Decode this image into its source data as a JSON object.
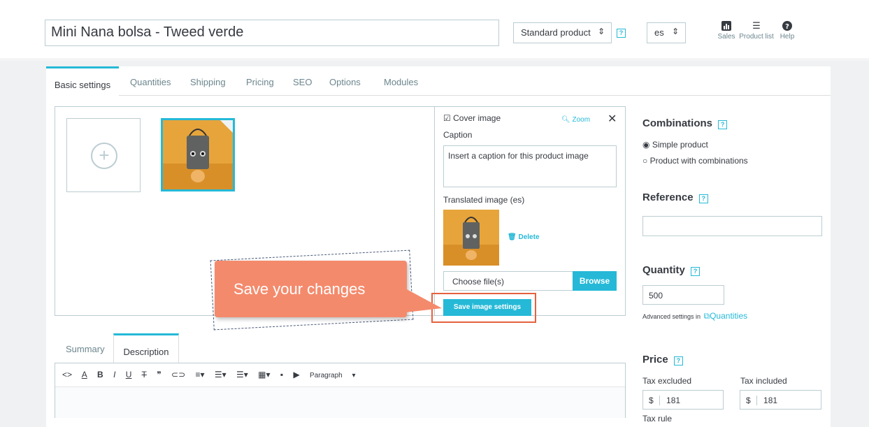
{
  "header": {
    "product_name": "Mini Nana bolsa - Tweed verde",
    "product_type": "Standard product",
    "language": "es",
    "tools": [
      {
        "icon": "bar-chart-icon",
        "label": "Sales"
      },
      {
        "icon": "list-icon",
        "label": "Product list"
      },
      {
        "icon": "help-circle-icon",
        "label": "Help"
      }
    ]
  },
  "tabs": [
    "Basic settings",
    "Quantities",
    "Shipping",
    "Pricing",
    "SEO",
    "Options",
    "Modules"
  ],
  "image_settings": {
    "cover_label": "Cover image",
    "zoom_label": "Zoom",
    "caption_label": "Caption",
    "caption_placeholder": "Insert a caption for this product image",
    "translated_label": "Translated image (es)",
    "delete_label": "Delete",
    "file_placeholder": "Choose file(s)",
    "browse_label": "Browse",
    "save_label": "Save image settings"
  },
  "callout": {
    "text": "Save your changes"
  },
  "description": {
    "tabs": [
      "Summary",
      "Description"
    ],
    "paragraph_label": "Paragraph"
  },
  "combinations": {
    "title": "Combinations",
    "options": [
      "Simple product",
      "Product with combinations"
    ]
  },
  "reference": {
    "title": "Reference",
    "value": ""
  },
  "quantity": {
    "title": "Quantity",
    "value": "500",
    "advanced_text": "Advanced settings in",
    "advanced_link": "Quantities"
  },
  "price": {
    "title": "Price",
    "tax_excluded_label": "Tax excluded",
    "tax_included_label": "Tax included",
    "currency": "$",
    "tax_excluded_value": "181",
    "tax_included_value": "181",
    "tax_rule_label": "Tax rule"
  },
  "colors": {
    "accent": "#25b9d7",
    "callout": "#f48a6c",
    "highlight": "#e5623f"
  }
}
